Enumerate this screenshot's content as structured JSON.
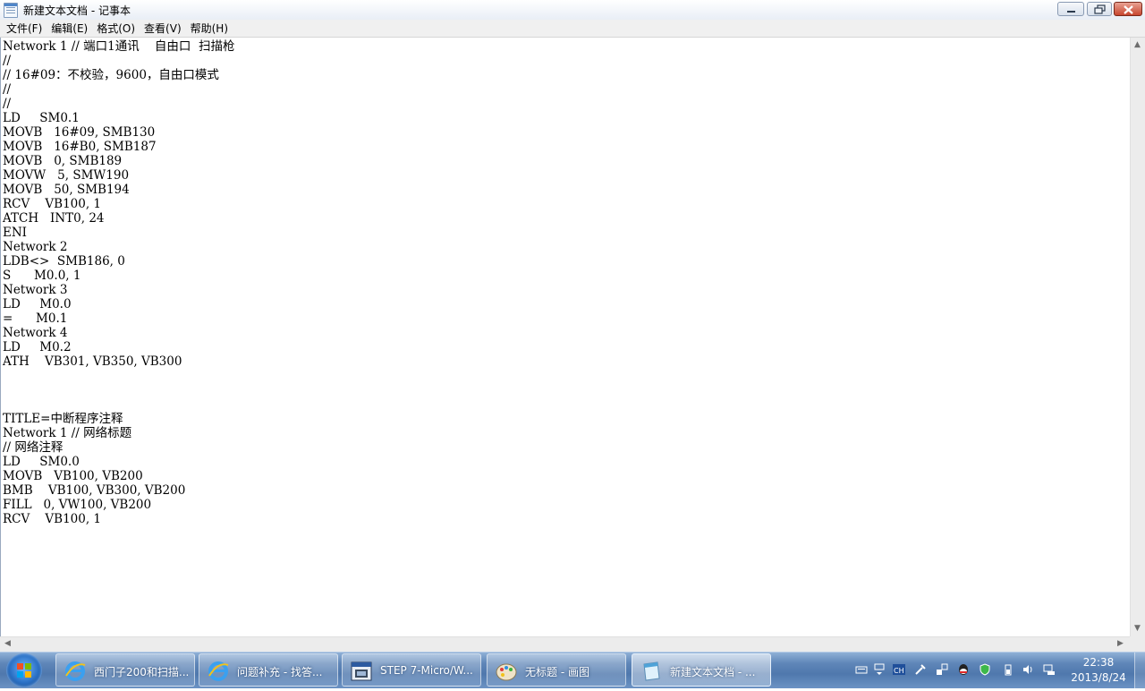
{
  "window": {
    "title": "新建文本文档 - 记事本"
  },
  "menu": [
    {
      "label": "文件(F)"
    },
    {
      "label": "编辑(E)"
    },
    {
      "label": "格式(O)"
    },
    {
      "label": "查看(V)"
    },
    {
      "label": "帮助(H)"
    }
  ],
  "editor": {
    "content": "Network 1 // 端口1通讯    自由口  扫描枪\n//\n// 16#09：不校验，9600，自由口模式\n//\n//\nLD     SM0.1\nMOVB   16#09, SMB130\nMOVB   16#B0, SMB187\nMOVB   0, SMB189\nMOVW   5, SMW190\nMOVB   50, SMB194\nRCV    VB100, 1\nATCH   INT0, 24\nENI\nNetwork 2\nLDB<>  SMB186, 0\nS      M0.0, 1\nNetwork 3\nLD     M0.0\n=      M0.1\nNetwork 4\nLD     M0.2\nATH    VB301, VB350, VB300\n\n\n\nTITLE=中断程序注释\nNetwork 1 // 网络标题\n// 网络注释\nLD     SM0.0\nMOVB   VB100, VB200\nBMB    VB100, VB300, VB200\nFILL   0, VW100, VB200\nRCV    VB100, 1"
  },
  "taskbar": {
    "items": [
      {
        "label": "西门子200和扫描...",
        "icon": "ie-icon"
      },
      {
        "label": "问题补充 - 找答...",
        "icon": "ie-icon"
      },
      {
        "label": "STEP 7-Micro/W...",
        "icon": "step7-icon"
      },
      {
        "label": "无标题 - 画图",
        "icon": "paint-icon"
      },
      {
        "label": "新建文本文档 - ...",
        "icon": "notepad-icon"
      }
    ],
    "clock": {
      "time": "22:38",
      "date": "2013/8/24"
    }
  },
  "colors": {
    "taskbar": "#5f86b8",
    "close_button": "#c7462f"
  }
}
